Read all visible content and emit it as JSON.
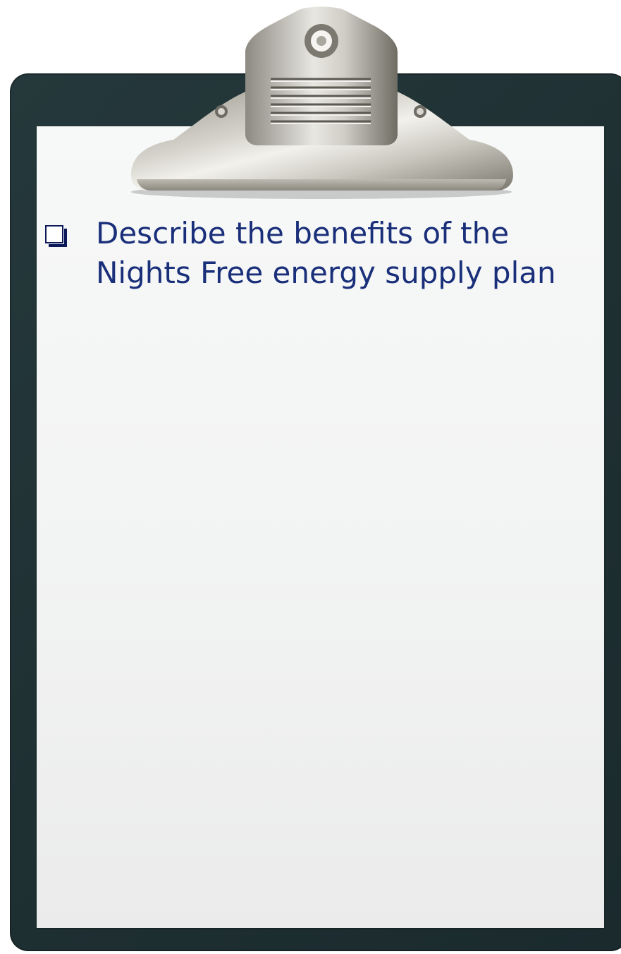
{
  "clipboard": {
    "items": [
      {
        "text": "Describe the benefits of the Nights Free energy supply plan",
        "checked": false
      }
    ]
  },
  "colors": {
    "board": "#22353a",
    "paper": "#f4f5f5",
    "text": "#1a2f7a",
    "checkbox": "#0c1a5a"
  },
  "icons": [
    "checkbox-icon",
    "metal-clip"
  ]
}
